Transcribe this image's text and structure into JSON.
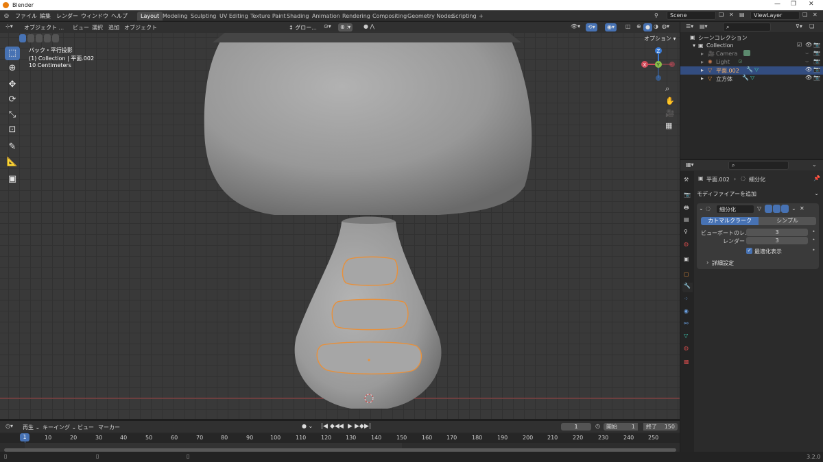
{
  "app": {
    "title": "Blender",
    "version": "3.2.0"
  },
  "menu": {
    "items": [
      "ファイル",
      "編集",
      "レンダー",
      "ウィンドウ",
      "ヘルプ"
    ]
  },
  "workspaces": [
    "Layout",
    "Modeling",
    "Sculpting",
    "UV Editing",
    "Texture Paint",
    "Shading",
    "Animation",
    "Rendering",
    "Compositing",
    "Geometry Nodes",
    "Scripting"
  ],
  "scene": {
    "name": "Scene",
    "view_layer": "ViewLayer"
  },
  "viewport_header": {
    "mode": "オブジェクト ...",
    "menus": [
      "ビュー",
      "選択",
      "追加",
      "オブジェクト"
    ],
    "transform": "グロー...",
    "options": "オプション"
  },
  "overlay": {
    "view_name": "バック・平行投影",
    "collection_info": "(1) Collection | 平面.002",
    "scale": "10 Centimeters"
  },
  "gizmo": {
    "z": "Z",
    "x": "X",
    "y": "Y"
  },
  "outliner": {
    "scene_collection": "シーンコレクション",
    "collection": "Collection",
    "items": [
      "Camera",
      "Light",
      "平面.002",
      "立方体"
    ]
  },
  "properties": {
    "object": "平面.002",
    "modifier_tab": "細分化",
    "add_modifier": "モディファイアーを追加",
    "modifier_name": "細分化",
    "catmull": "カトマルクラーク",
    "simple": "シンプル",
    "viewport_label": "ビューポートのレ...",
    "viewport_value": "3",
    "render_label": "レンダー",
    "render_value": "3",
    "optimal": "最適化表示",
    "advanced": "詳細設定"
  },
  "timeline": {
    "menus": [
      "再生",
      "キーイング",
      "ビュー",
      "マーカー"
    ],
    "current_frame": "1",
    "start_label": "開始",
    "start": "1",
    "end_label": "終了",
    "end": "150",
    "ticks": [
      "10",
      "20",
      "30",
      "40",
      "50",
      "60",
      "70",
      "80",
      "90",
      "100",
      "110",
      "120",
      "130",
      "140",
      "150",
      "160",
      "170",
      "180",
      "190",
      "200",
      "210",
      "220",
      "230",
      "240",
      "250"
    ]
  },
  "colors": {
    "accent": "#4772b3",
    "selected": "#e8903a",
    "active_row": "#334d80"
  }
}
